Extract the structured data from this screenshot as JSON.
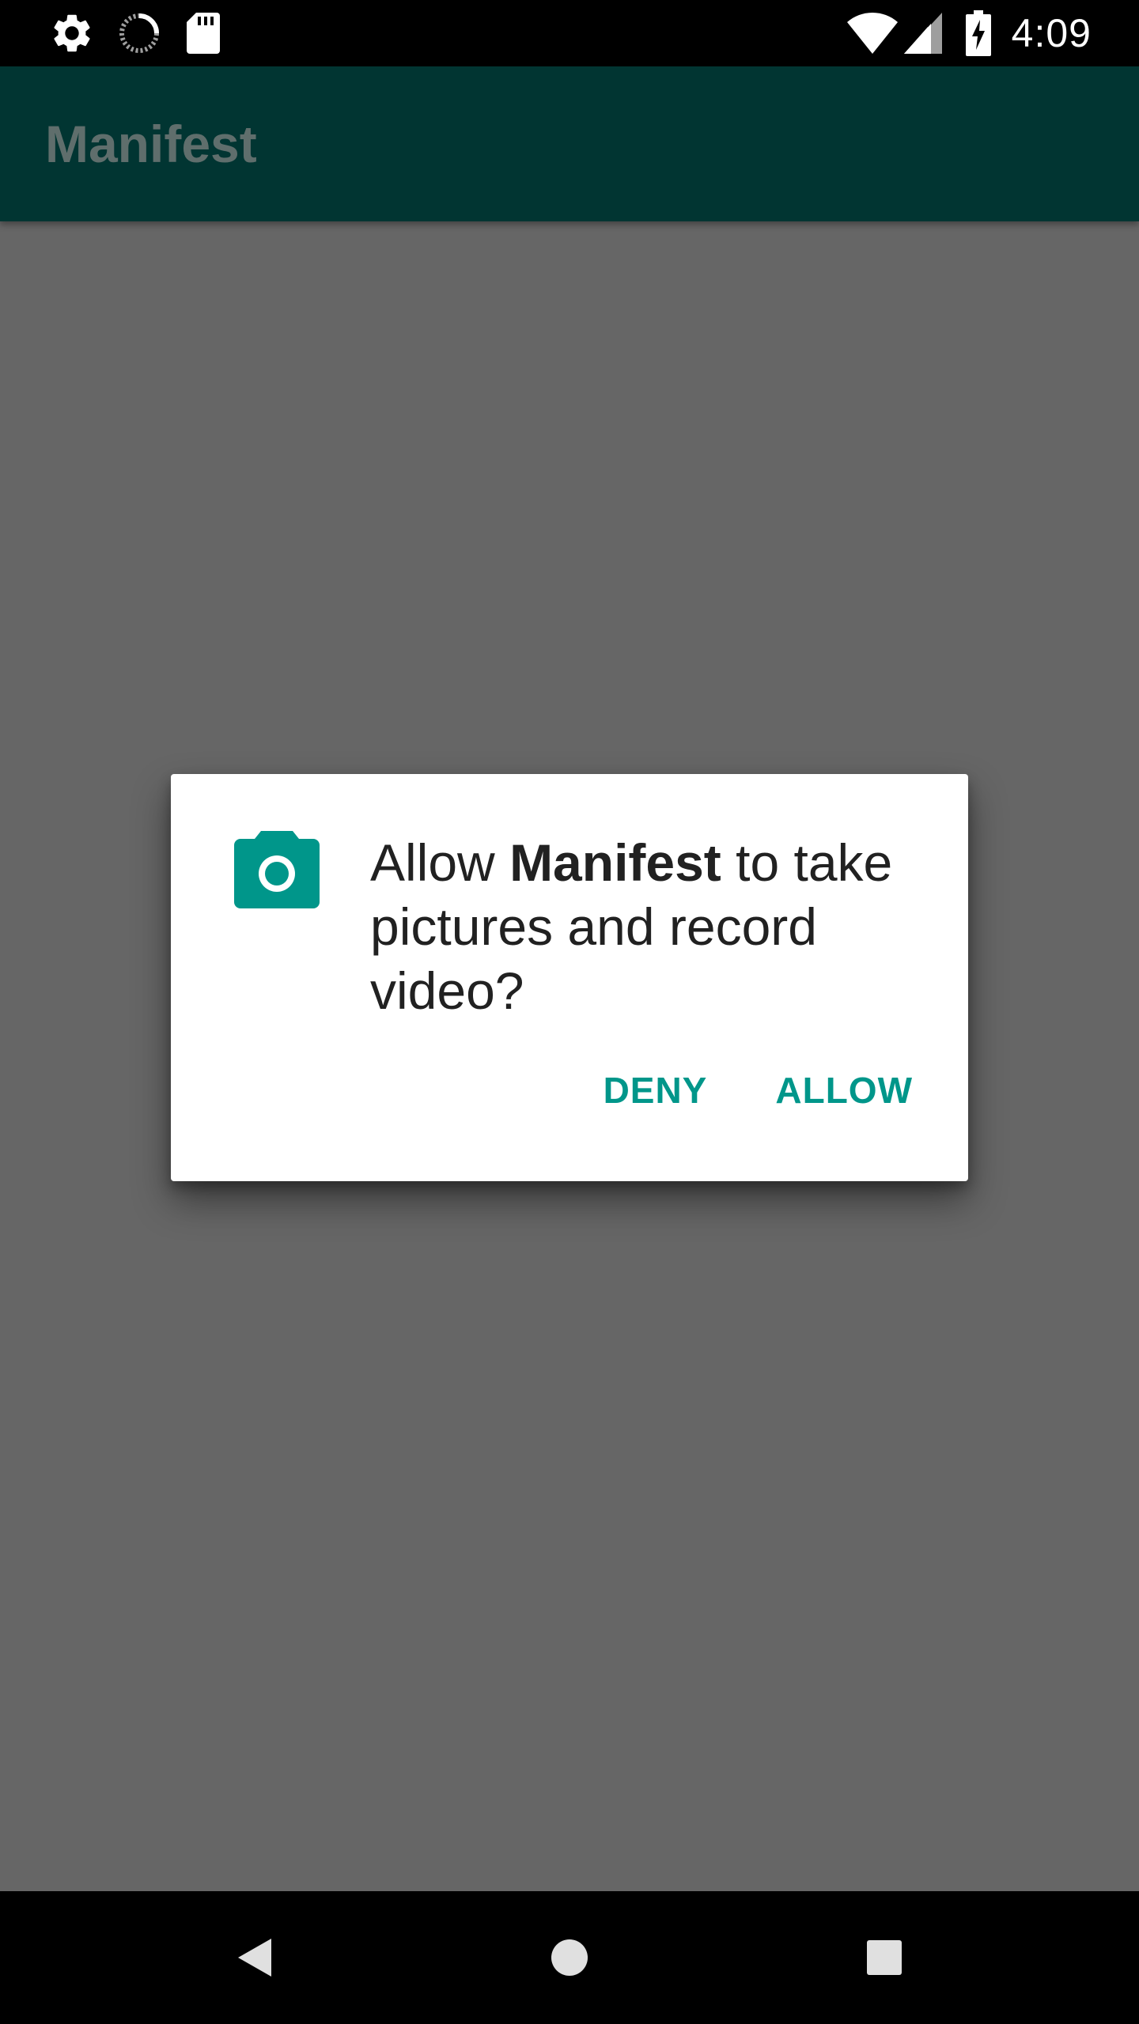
{
  "status_bar": {
    "time": "4:09",
    "left_icons": [
      "gear-icon",
      "sync-icon",
      "sd-card-icon"
    ],
    "right_icons": [
      "wifi-icon",
      "signal-icon",
      "battery-charging-icon"
    ]
  },
  "app_bar": {
    "title": "Manifest"
  },
  "dialog": {
    "icon": "camera-icon",
    "message_prefix": "Allow ",
    "app_name": "Manifest",
    "message_suffix": " to take pictures and record video?",
    "deny_label": "DENY",
    "allow_label": "ALLOW"
  },
  "nav_bar": {
    "icons": [
      "back-icon",
      "home-icon",
      "recents-icon"
    ]
  },
  "colors": {
    "app_bar": "#013532",
    "scrim_background": "#666666",
    "accent": "#00968a",
    "dialog_background": "#ffffff"
  }
}
